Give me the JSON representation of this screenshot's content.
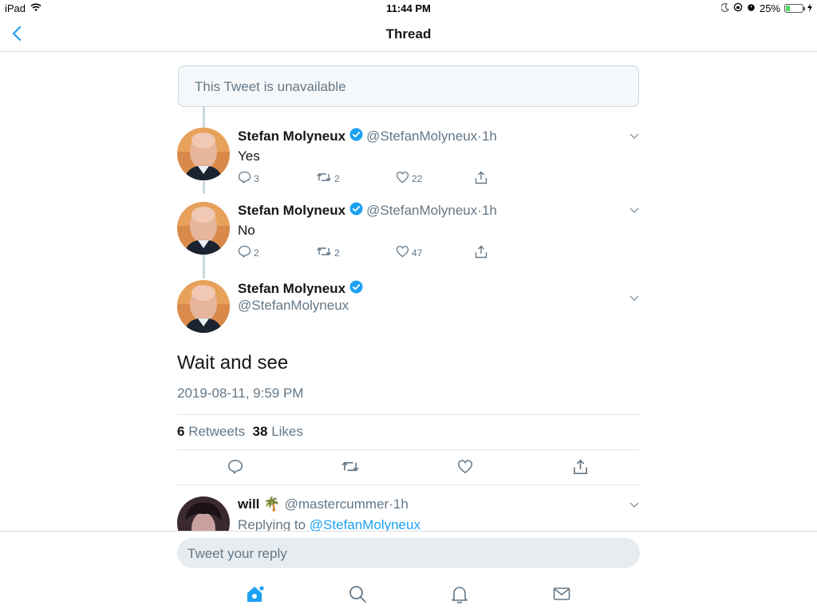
{
  "status_bar": {
    "device": "iPad",
    "time": "11:44 PM",
    "battery": "25%"
  },
  "nav": {
    "title": "Thread"
  },
  "unavailable_text": "This Tweet is unavailable",
  "tweets": [
    {
      "name": "Stefan Molyneux",
      "handle": "@StefanMolyneux",
      "time": "1h",
      "text": "Yes",
      "replies": "3",
      "retweets": "2",
      "likes": "22"
    },
    {
      "name": "Stefan Molyneux",
      "handle": "@StefanMolyneux",
      "time": "1h",
      "text": "No",
      "replies": "2",
      "retweets": "2",
      "likes": "47"
    }
  ],
  "main_tweet": {
    "name": "Stefan Molyneux",
    "handle": "@StefanMolyneux",
    "text": "Wait and see",
    "date": "2019-08-11, 9:59 PM",
    "retweets_count": "6",
    "retweets_label": "Retweets",
    "likes_count": "38",
    "likes_label": "Likes"
  },
  "reply_tweet": {
    "name": "will",
    "emoji": "🌴",
    "handle": "@mastercummer",
    "time": "1h",
    "replying_label": "Replying to",
    "replying_to": "@StefanMolyneux"
  },
  "reply_box": {
    "placeholder": "Tweet your reply"
  },
  "colors": {
    "accent": "#1da1f2",
    "secondary_text": "#657786",
    "border": "#e1e8ed"
  }
}
